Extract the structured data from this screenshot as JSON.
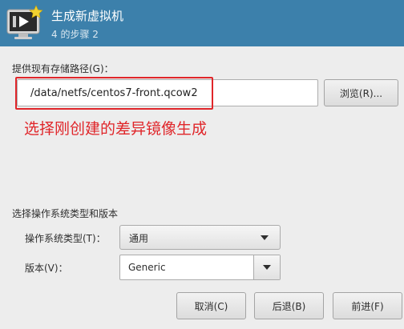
{
  "header": {
    "title": "生成新虚拟机",
    "step": "4 的步骤 2",
    "icon": "monitor-play-star-icon"
  },
  "storage": {
    "label": "提供现有存储路径(G)：",
    "path_value": "/data/netfs/centos7-front.qcow2",
    "browse_label": "浏览(R)..."
  },
  "annotation": {
    "text": "选择刚创建的差异镜像生成",
    "color": "#e0262a"
  },
  "os": {
    "section_label": "选择操作系统类型和版本",
    "type_label": "操作系统类型(T)：",
    "type_value": "通用",
    "version_label": "版本(V)：",
    "version_value": "Generic"
  },
  "buttons": {
    "cancel": "取消(C)",
    "back": "后退(B)",
    "forward": "前进(F)"
  },
  "colors": {
    "header_bg": "#3c80ab",
    "window_bg": "#ededed"
  }
}
